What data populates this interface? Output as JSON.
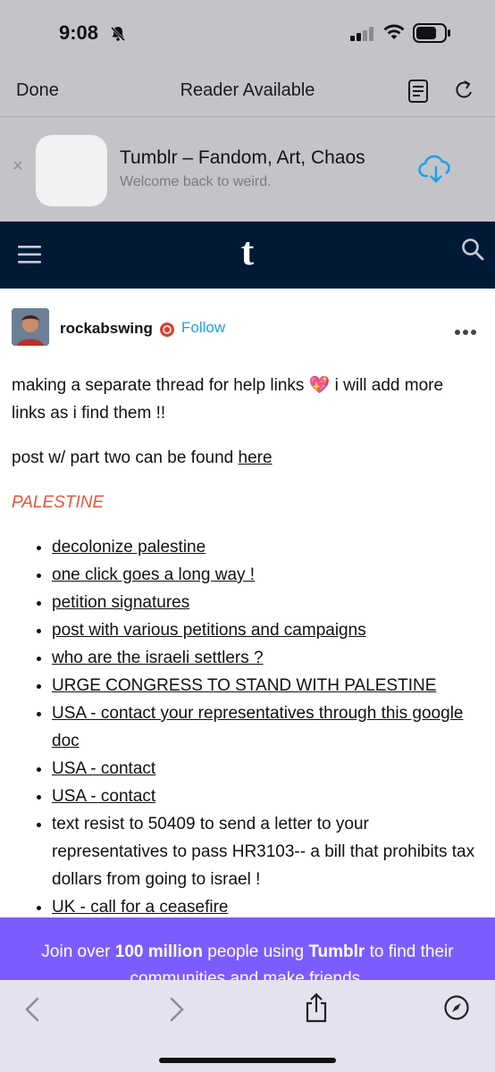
{
  "status_bar": {
    "time": "9:08"
  },
  "browser": {
    "done_label": "Done",
    "reader_label": "Reader Available"
  },
  "app_banner": {
    "close_symbol": "×",
    "title": "Tumblr – Fandom, Art, Chaos",
    "subtitle": "Welcome back to weird."
  },
  "header": {
    "logo": "t"
  },
  "post": {
    "username": "rockabswing",
    "follow_label": "Follow",
    "intro_text": "making a separate thread for help links 💖 i will add more links as i find them !!",
    "part_two_prefix": "post w/ part two can be found ",
    "part_two_link": "here",
    "section_title": "PALESTINE",
    "links": [
      "decolonize palestine",
      "one click goes a long way !",
      "petition signatures",
      "post with various petitions and campaigns",
      "who are the israeli settlers ?",
      "URGE CONGRESS TO STAND WITH PALESTINE",
      "USA - contact your representatives through this google doc",
      "USA - contact",
      "USA - contact"
    ],
    "text_item": "text resist to 50409 to send a letter to your representatives to pass HR3103-- a bill that prohibits tax dollars from going to israel !",
    "last_link": "UK - call for a ceasefire"
  },
  "join_banner": {
    "prefix": "Join over ",
    "count": "100 million",
    "middle": " people using ",
    "brand": "Tumblr",
    "suffix": " to find their communities and make friends."
  },
  "icons": {
    "accent": "#1ea0e6",
    "header_bg": "#001935",
    "banner_purple": "#7c5cff",
    "section_red": "#e8553a"
  }
}
